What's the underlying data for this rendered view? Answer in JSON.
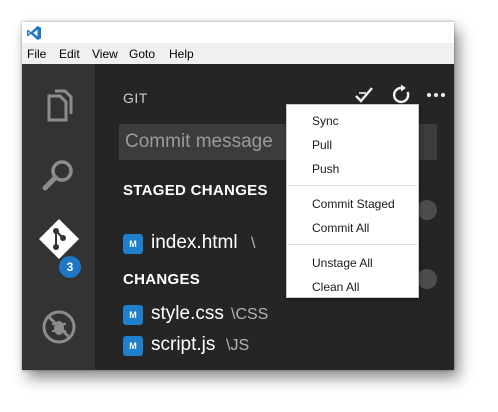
{
  "menubar": {
    "file": "File",
    "edit": "Edit",
    "view": "View",
    "goto": "Goto",
    "help": "Help"
  },
  "activity_bar": {
    "git_badge_count": "3"
  },
  "git_panel": {
    "title": "GIT",
    "commit_placeholder": "Commit message",
    "staged_header": "STAGED CHANGES",
    "changes_header": "CHANGES",
    "staged_files": [
      {
        "status": "M",
        "name": "index.html",
        "dir": "\\"
      }
    ],
    "changed_files": [
      {
        "status": "M",
        "name": "style.css",
        "dir": "\\CSS"
      },
      {
        "status": "M",
        "name": "script.js",
        "dir": "\\JS"
      }
    ]
  },
  "context_menu": {
    "items": [
      "Sync",
      "Pull",
      "Push",
      "Commit Staged",
      "Commit All",
      "Unstage All",
      "Clean All"
    ]
  },
  "colors": {
    "accent": "#1e76c6",
    "sidebar_bg": "#252526",
    "activity_bg": "#333333"
  },
  "icons": {
    "app": "vscode-logo-icon",
    "explorer": "files-icon",
    "search": "search-icon",
    "git": "git-icon",
    "debug": "debug-icon",
    "commit": "checkmark-icon",
    "refresh": "refresh-icon",
    "more": "ellipsis-icon"
  }
}
